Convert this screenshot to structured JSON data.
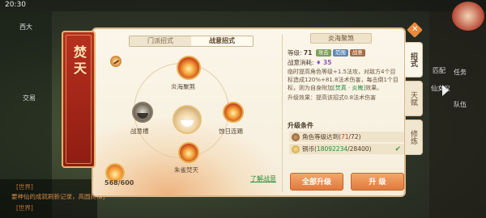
{
  "hud": {
    "clock": "20:30",
    "left_labels": [
      "西大",
      "交易"
    ],
    "right_labels": [
      "任务",
      "队伍",
      "匹配",
      "仙女仪"
    ],
    "chat": [
      "[世界]",
      "要神仙的成就刷新记录，高圆爬梯]",
      "[世界]"
    ]
  },
  "panel": {
    "banner_title": "焚天",
    "tabs": [
      "门派招式",
      "战意招式"
    ],
    "active_tab": 1,
    "skills": [
      {
        "id": "yanhai",
        "label": "炎海聚煞"
      },
      {
        "id": "zhanyi",
        "label": "战意槽"
      },
      {
        "id": "center",
        "label": ""
      },
      {
        "id": "shiri",
        "label": "蚀日连踢"
      },
      {
        "id": "zhuque",
        "label": "朱雀焚天"
      }
    ],
    "energy": "568/600",
    "link": "了解战意"
  },
  "detail": {
    "title": "炎海聚煞",
    "level_label": "等级:",
    "level_value": "71",
    "tags": [
      "攻击",
      "范围",
      "战意"
    ],
    "energy_label": "战意消耗:",
    "energy_value": "35",
    "desc_prefix": "临时提高角色等级+1.5法攻，对敌方4个目标造成120%+81.8法术伤害，每击倒1个目标，则为自身附加",
    "desc_highlight": "[焚真 · 炎魄]",
    "desc_suffix": "效果。",
    "upgrade": "升级效果：提高该招式0.8法术伤害",
    "conditions_title": "升级条件",
    "conditions": [
      {
        "text_prefix": "角色等级达到(",
        "current": "71",
        "sep": "/",
        "required": "72",
        "text_suffix": ")",
        "met": false
      },
      {
        "text_prefix": "铜币(",
        "current": "18092234",
        "sep": "/",
        "required": "28400",
        "text_suffix": ")",
        "met": true
      }
    ],
    "btn_all": "全部升级",
    "btn_one": "升  级"
  },
  "sidetabs": [
    "招式",
    "天赋",
    "修炼"
  ],
  "colors": {
    "accent": "#e07a3d",
    "banner": "#a8261a",
    "green": "#2e8a3a",
    "red": "#c53a2a"
  }
}
